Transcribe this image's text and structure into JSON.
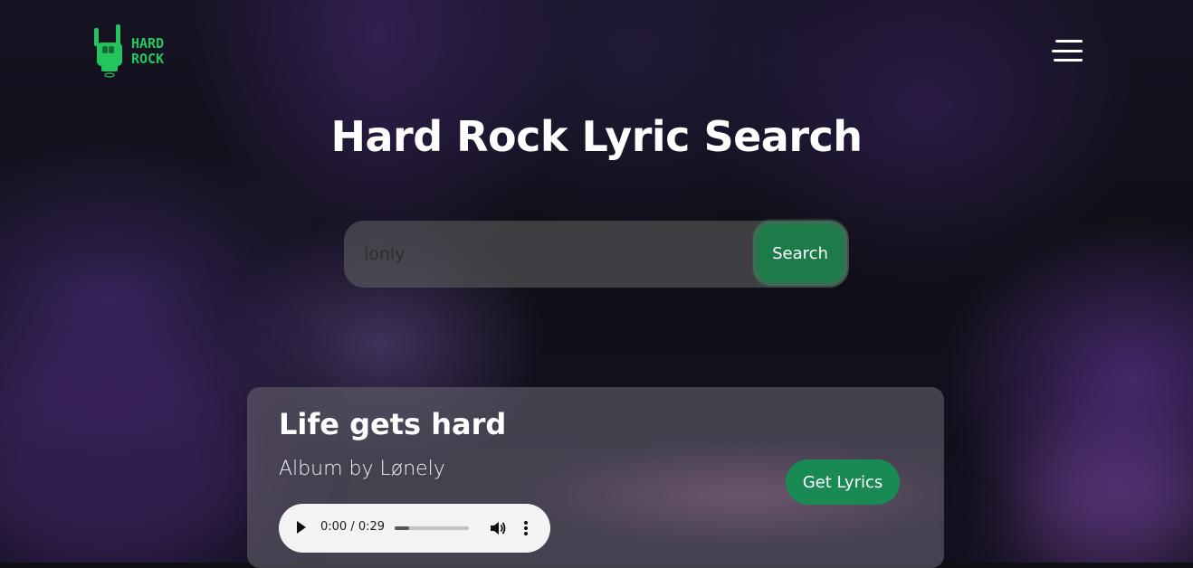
{
  "header": {
    "logo_text": "HARD\nROCK",
    "menu_icon": "hamburger-menu-icon"
  },
  "main": {
    "title": "Hard Rock Lyric Search",
    "search": {
      "value": "lonly",
      "button_label": "Search"
    }
  },
  "results": [
    {
      "title": "Life gets hard",
      "album": "Album by Lønely",
      "button_label": "Get Lyrics",
      "audio": {
        "time": "0:00 / 0:29",
        "progress": 0.2
      }
    }
  ],
  "colors": {
    "accent": "#22c55e",
    "button": "#1a8a54",
    "background": "#0f1016"
  }
}
